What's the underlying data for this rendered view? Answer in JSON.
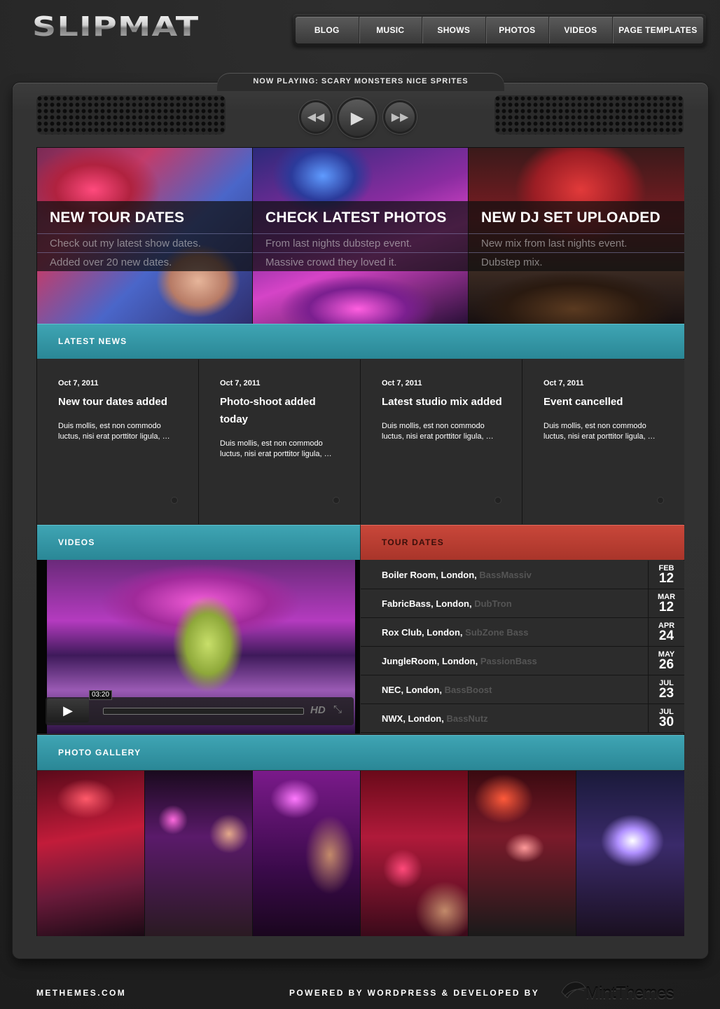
{
  "brand": {
    "logo": "SLIPMAT"
  },
  "nav": [
    {
      "label": "BLOG"
    },
    {
      "label": "MUSIC"
    },
    {
      "label": "SHOWS"
    },
    {
      "label": "PHOTOS"
    },
    {
      "label": "VIDEOS"
    },
    {
      "label": "PAGE TEMPLATES"
    }
  ],
  "player": {
    "now_playing_prefix": "NOW PLAYING:",
    "now_playing_track": "SCARY MONSTERS NICE SPRITES",
    "rewind_icon": "rewind-icon",
    "play_icon": "play-icon",
    "forward_icon": "fast-forward-icon"
  },
  "featured": [
    {
      "title": "NEW TOUR DATES",
      "line1": "Check out my latest show dates.",
      "line2": "Added over 20 new dates."
    },
    {
      "title": "CHECK LATEST PHOTOS",
      "line1": "From last nights dubstep event.",
      "line2": "Massive crowd they loved it."
    },
    {
      "title": "NEW DJ SET UPLOADED",
      "line1": "New mix from last nights event.",
      "line2": "Dubstep mix."
    }
  ],
  "latest_news": {
    "heading": "LATEST NEWS",
    "items": [
      {
        "date": "Oct 7, 2011",
        "title": "New tour dates added",
        "excerpt": "Duis mollis, est non commodo luctus, nisi erat porttitor ligula, …"
      },
      {
        "date": "Oct 7, 2011",
        "title": "Photo-shoot added today",
        "excerpt": "Duis mollis, est non commodo luctus, nisi erat porttitor ligula, …"
      },
      {
        "date": "Oct 7, 2011",
        "title": "Latest studio mix added",
        "excerpt": "Duis mollis, est non commodo luctus, nisi erat porttitor ligula, …"
      },
      {
        "date": "Oct 7, 2011",
        "title": "Event cancelled",
        "excerpt": "Duis mollis, est non commodo luctus, nisi erat porttitor ligula, …"
      }
    ]
  },
  "videos": {
    "heading": "VIDEOS",
    "time": "03:20",
    "hd_label": "HD"
  },
  "tour_dates": {
    "heading": "TOUR DATES",
    "items": [
      {
        "venue": "Boiler Room, London,",
        "act": "BassMassiv",
        "month": "FEB",
        "day": "12"
      },
      {
        "venue": "FabricBass, London,",
        "act": "DubTron",
        "month": "MAR",
        "day": "12"
      },
      {
        "venue": "Rox Club, London,",
        "act": "SubZone Bass",
        "month": "APR",
        "day": "24"
      },
      {
        "venue": "JungleRoom, London,",
        "act": "PassionBass",
        "month": "MAY",
        "day": "26"
      },
      {
        "venue": "NEC, London,",
        "act": "BassBoost",
        "month": "JUL",
        "day": "23"
      },
      {
        "venue": "NWX, London,",
        "act": "BassNutz",
        "month": "JUL",
        "day": "30"
      }
    ]
  },
  "gallery": {
    "heading": "PHOTO GALLERY"
  },
  "footer": {
    "left": "METHEMES.COM",
    "right": "POWERED BY WORDPRESS & DEVELOPED BY",
    "partner": "MintThemes"
  },
  "colors": {
    "teal": "#3a9fae",
    "red": "#c0433a",
    "panel": "#2c2c2c"
  }
}
